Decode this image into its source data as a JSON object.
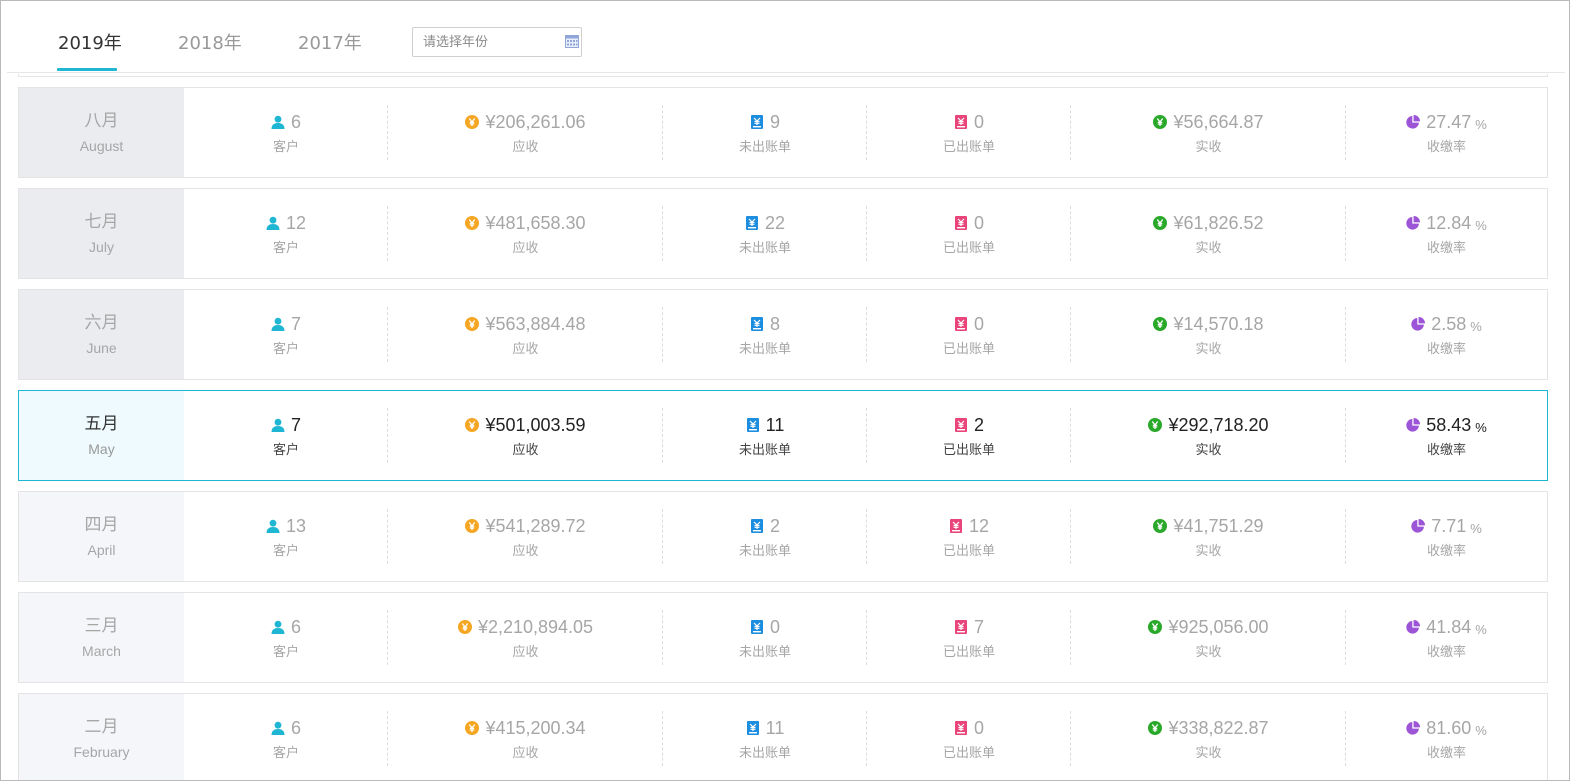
{
  "tabs": [
    {
      "label": "2019年",
      "active": true
    },
    {
      "label": "2018年",
      "active": false
    },
    {
      "label": "2017年",
      "active": false
    }
  ],
  "year_picker": {
    "placeholder": "请选择年份",
    "icon": "calendar-icon"
  },
  "labels": {
    "customers": "客户",
    "receivable": "应收",
    "unbilled": "未出账单",
    "billed": "已出账单",
    "received": "实收",
    "rate": "收缴率",
    "pct": "%"
  },
  "colors": {
    "accent": "#1fb6d3",
    "customer_icon": "#1fb6d3",
    "receivable_icon": "#f5a623",
    "unbilled_icon": "#1d8de0",
    "billed_icon": "#e9457a",
    "received_icon": "#2aa82a",
    "rate_icon": "#9c55d6"
  },
  "months": [
    {
      "cn": "八月",
      "en": "August",
      "customers": "6",
      "receivable": "¥206,261.06",
      "unbilled": "9",
      "billed": "0",
      "received": "¥56,664.87",
      "rate": "27.47",
      "selected": false
    },
    {
      "cn": "七月",
      "en": "July",
      "customers": "12",
      "receivable": "¥481,658.30",
      "unbilled": "22",
      "billed": "0",
      "received": "¥61,826.52",
      "rate": "12.84",
      "selected": false
    },
    {
      "cn": "六月",
      "en": "June",
      "customers": "7",
      "receivable": "¥563,884.48",
      "unbilled": "8",
      "billed": "0",
      "received": "¥14,570.18",
      "rate": "2.58",
      "selected": false
    },
    {
      "cn": "五月",
      "en": "May",
      "customers": "7",
      "receivable": "¥501,003.59",
      "unbilled": "11",
      "billed": "2",
      "received": "¥292,718.20",
      "rate": "58.43",
      "selected": true
    },
    {
      "cn": "四月",
      "en": "April",
      "customers": "13",
      "receivable": "¥541,289.72",
      "unbilled": "2",
      "billed": "12",
      "received": "¥41,751.29",
      "rate": "7.71",
      "selected": false
    },
    {
      "cn": "三月",
      "en": "March",
      "customers": "6",
      "receivable": "¥2,210,894.05",
      "unbilled": "0",
      "billed": "7",
      "received": "¥925,056.00",
      "rate": "41.84",
      "selected": false
    },
    {
      "cn": "二月",
      "en": "February",
      "customers": "6",
      "receivable": "¥415,200.34",
      "unbilled": "11",
      "billed": "0",
      "received": "¥338,822.87",
      "rate": "81.60",
      "selected": false
    }
  ]
}
